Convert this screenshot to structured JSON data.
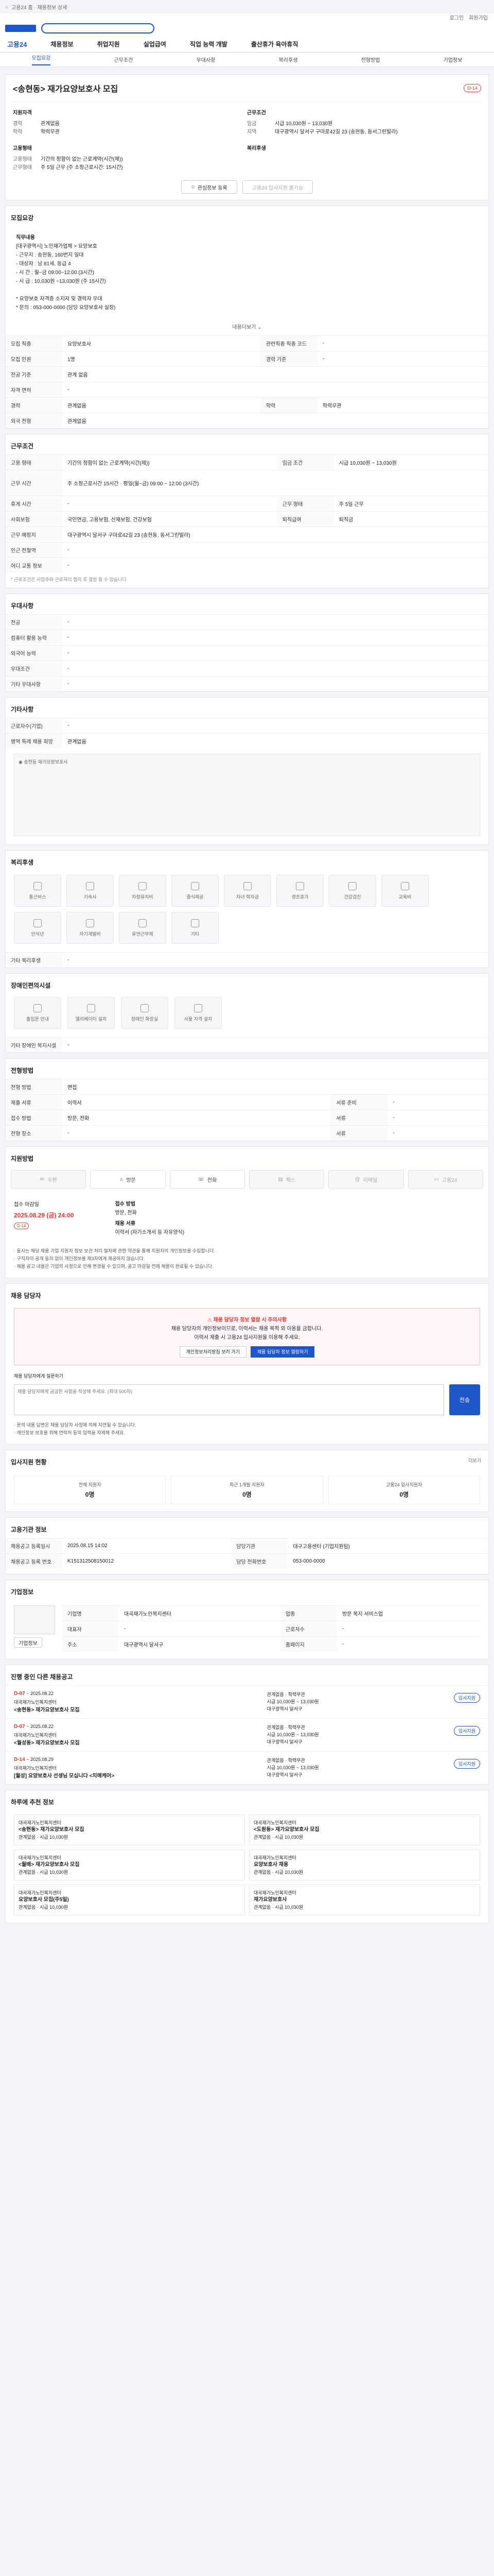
{
  "top": {
    "breadcrumb": "고용24 홈 · 채용정보 상세",
    "links": [
      "로그인",
      "회원가입"
    ]
  },
  "gnb": {
    "brand": "고용24",
    "items": [
      "채용정보",
      "취업지원",
      "실업급여",
      "직업 능력 개발",
      "출산휴가 육아휴직"
    ]
  },
  "tabs": [
    "모집요강",
    "근무조건",
    "우대사항",
    "복리후생",
    "전형방법",
    "기업정보"
  ],
  "job": {
    "title": "<송현동> 재가요양보호사 모집",
    "dday": "D-14",
    "left_head": "지원자격",
    "left_kv": [
      {
        "k": "경력",
        "v": "관계없음"
      },
      {
        "k": "학력",
        "v": "학력무관"
      }
    ],
    "left_head2": "고용형태",
    "left_kv2": [
      {
        "k": "고용형태",
        "v": "기간의 정함이 없는 근로계약(시간(제))"
      },
      {
        "k": "근무형태",
        "v": "주 5일 근무 (주 소정근로시간: 15시간)"
      }
    ],
    "right_head": "근무조건",
    "right_kv": [
      {
        "k": "임금",
        "v": "시급 10,030원 ~ 13,030원"
      },
      {
        "k": "지역",
        "v": "대구광역시 달서구 구마로42길 23 (송현동, 동서그린빌라)"
      }
    ],
    "right_head2": "복리후생",
    "btn_interest": "관심정보 등록",
    "btn_apply": "고용24 입사지원 불가능"
  },
  "recruit": {
    "title": "모집요강",
    "content_lines": [
      "직무내용",
      "[대구광역시] 노인재가업체 > 요양보호",
      "- 근무지 : 송현동, 160번지 일대",
      "- 대상자 : 남 81세, 등급 4",
      "- 시 간 : 월~금 09:00~12:00 (3시간)",
      "- 시 급 : 10,030원 ~13,030원 (주 15시간)",
      "",
      "* 요양보호 자격증 소지자 및 경력자 우대",
      "* 문의 : 053-000-0000 (담당 요양보호사 실장)"
    ],
    "more": "내용더보기"
  },
  "recruit_table": [
    {
      "h": "모집 직종",
      "v": "요양보호사",
      "h2": "관련직종 직종 코드",
      "v2": "-"
    },
    {
      "h": "모집 인원",
      "v": "1명",
      "h2": "경력 기준",
      "v2": "-"
    },
    {
      "h": "전공 기준",
      "v": "관계 없음",
      "h2": "",
      "v2": ""
    },
    {
      "h": "자격 면허",
      "v": "-",
      "h2": "",
      "v2": ""
    },
    {
      "h": "경력",
      "v": "관계없음",
      "h2": "학력",
      "v2": "학력무관"
    },
    {
      "h": "외국 전형",
      "v": "관계없음",
      "h2": "",
      "v2": ""
    }
  ],
  "work": {
    "title": "근무조건",
    "rows": [
      {
        "h": "고용 형태",
        "v": "기간의 정함이 없는 근로계약(시간(제))",
        "h2": "임금 조건",
        "v2": "시급 10,030원 ~ 13,030원"
      },
      {
        "h": "근무 시간",
        "v": "주 소정근로시간 15시간 · 평일(월~금) 09:00 ~ 12:00 (3시간)",
        "h2": "",
        "v2": ""
      },
      {
        "h": "휴게 시간",
        "v": "-",
        "h2": "근무 형태",
        "v2": "주 5일 근무"
      },
      {
        "h": "사회보험",
        "v": "국민연금, 고용보험, 산재보험, 건강보험",
        "h2": "퇴직급여",
        "v2": "퇴직금"
      },
      {
        "h": "근무 예정지",
        "v": "대구광역시 달서구 구마로42길 23 (송현동, 동서그린빌라)",
        "h2": "",
        "v2": ""
      },
      {
        "h": "인근 전철역",
        "v": "-",
        "h2": "",
        "v2": ""
      },
      {
        "h": "어디 교통 정보",
        "v": "-",
        "h2": "",
        "v2": ""
      }
    ],
    "note": "* 근로조건은 사업주와 근로자의 협의 후 결정 될 수 있습니다."
  },
  "prefer": {
    "title": "우대사항",
    "rows": [
      {
        "h": "전공",
        "v": "-"
      },
      {
        "h": "컴퓨터 활용 능력",
        "v": "-"
      },
      {
        "h": "외국어 능력",
        "v": "-"
      },
      {
        "h": "우대조건",
        "v": "-"
      },
      {
        "h": "기타 우대사항",
        "v": "-"
      }
    ]
  },
  "company_info": {
    "title": "기타사항",
    "rows": [
      {
        "h": "근로자수(기업)",
        "v": "-"
      },
      {
        "h": "병역 특례 채용 희망",
        "v": "관계없음"
      }
    ],
    "map_label": "송현동 재가요양보호사"
  },
  "welfare": {
    "title": "복리후생",
    "items": [
      "통근버스",
      "기숙사",
      "차량유지비",
      "중식제공",
      "자녀 학자금",
      "경조휴가",
      "건강검진",
      "교육비",
      "안식년",
      "자기계발비",
      "유연근무제",
      "기타"
    ],
    "etc_label": "기타 복리후생",
    "etc_value": "-"
  },
  "disability": {
    "title": "장애인편의시설",
    "items": [
      "출입문 안내",
      "엘리베이터 설치",
      "장애인 화장실",
      "사용 자격 설치"
    ],
    "info_label": "기타 장애인 복지시설",
    "info_value": "-"
  },
  "selection": {
    "title": "전형방법",
    "rows": [
      {
        "h": "전형 방법",
        "v": "면접"
      },
      {
        "h": "제출 서류",
        "v": "이력서",
        "h2": "서류 준비",
        "v2": "-"
      },
      {
        "h": "접수 방법",
        "v": "방문, 전화",
        "h2": "서류",
        "v2": "-"
      },
      {
        "h": "전형 장소",
        "v": "-",
        "h2": "서류",
        "v2": "-"
      }
    ]
  },
  "apply": {
    "title": "지원방법",
    "methods": [
      "우편",
      "방문",
      "전화",
      "팩스",
      "이메일",
      "고용24"
    ],
    "period_label": "접수 마감일",
    "period_value": "2025.08.29 (금) 24:00",
    "period_badge": "D-14",
    "contact_label": "접수 방법",
    "contact_value": "방문, 전화",
    "contact_label2": "채용 서류",
    "contact_value2": "이력서 (자기소개서 등 자유양식)",
    "bullets": [
      "· 동사는 해당 채용 기업 지원자 정보 보관 처리 절차에 관한 약관을 통해 지원자의 개인정보를 수집합니다.",
      "· 구직자의 공개 동의 없이 개인정보를 제3자에게 제공하지 않습니다.",
      "· 채용 공고 내용은 기업의 사정으로 인해 변경될 수 있으며, 공고 마감일 전에 채용이 완료될 수 있습니다."
    ]
  },
  "contact": {
    "title": "채용 담당자",
    "alert_red": "채용 담당자 정보 열람 시 주의사항",
    "alert_text1": "채용 담당자의 개인정보이므로, 이력서는 채용 목적 외 이용을 금합니다.",
    "alert_text2": "이력서 제출 시 고용24 입사지원을 이용해 주세요.",
    "btn1": "개인정보처리방침 보러 가기",
    "btn2": "채용 담당자 정보 열람하기",
    "qa_label": "채용 담당자에게 질문하기",
    "qa_placeholder": "채용 담당자에게 궁금한 사항을 작성해 주세요. (최대 500자)",
    "send": "전송",
    "notes": [
      "· 문의 내용 답변은 채용 담당자 사정에 의해 지연될 수 있습니다.",
      "· 개인정보 보호를 위해 연락처 등의 입력을 자제해 주세요."
    ]
  },
  "stats": {
    "title": "입사지원 현황",
    "more": "더보기",
    "items": [
      {
        "label": "전체 지원자",
        "value": "0명"
      },
      {
        "label": "최근 1개월 지원자",
        "value": "0명"
      },
      {
        "label": "고용24 입사지원자",
        "value": "0명"
      }
    ]
  },
  "meta": {
    "title": "고용기관 정보",
    "rows": [
      {
        "h": "채용공고 등록일시",
        "v": "2025.08.15 14:02",
        "h2": "담당기관",
        "v2": "대구고용센터 (기업지원팀)"
      },
      {
        "h": "채용공고 등록 번호",
        "v": "K151312508150012",
        "h2": "담당 전화번호",
        "v2": "053-000-0000"
      }
    ]
  },
  "employer": {
    "title": "기업정보",
    "rows": [
      {
        "h": "기업명",
        "v": "대곡재가노인복지센터",
        "h2": "업종",
        "v2": "방문 복지 서비스업"
      },
      {
        "h": "대표자",
        "v": "-",
        "h2": "근로자수",
        "v2": "-"
      },
      {
        "h": "주소",
        "v": "대구광역시 달서구",
        "h2": "홈페이지",
        "v2": "-"
      }
    ],
    "btn": "기업정보"
  },
  "similar": {
    "title": "진행 중인 다른 채용공고",
    "items": [
      {
        "dday": "D-07",
        "date": "~ 2025.08.22",
        "company": "대곡재가노인복지센터",
        "title": "<송현동> 재가요양보호사 모집",
        "cond1": "관계없음 · 학력무관",
        "cond2": "시급 10,030원 ~ 13,030원",
        "cond3": "대구광역시 달서구",
        "apply": "입사지원"
      },
      {
        "dday": "D-07",
        "date": "~ 2025.08.22",
        "company": "대곡재가노인복지센터",
        "title": "<월성동> 재가요양보호사 모집",
        "cond1": "관계없음 · 학력무관",
        "cond2": "시급 10,030원 ~ 13,030원",
        "cond3": "대구광역시 달서구",
        "apply": "입사지원"
      },
      {
        "dday": "D-14",
        "date": "~ 2025.08.29",
        "company": "대곡재가노인복지센터",
        "title": "[월성] 요양보호사 선생님 모십니다 <치매케어>",
        "cond1": "관계없음 · 학력무관",
        "cond2": "시급 10,030원 ~ 13,030원",
        "cond3": "대구광역시 달서구",
        "apply": "입사지원"
      }
    ]
  },
  "reco": {
    "title": "하루에 추천 정보",
    "items": [
      {
        "company": "대곡재가노인복지센터",
        "title": "<송현동> 재가요양보호사 모집",
        "info": "관계없음 · 시급 10,030원"
      },
      {
        "company": "대곡재가노인복지센터",
        "title": "<도원동> 재가요양보호사 모집",
        "info": "관계없음 · 시급 10,030원"
      },
      {
        "company": "대곡재가노인복지센터",
        "title": "<월배> 재가요양보호사 모집",
        "info": "관계없음 · 시급 10,030원"
      },
      {
        "company": "대곡재가노인복지센터",
        "title": "요양보호사 채용",
        "info": "관계없음 · 시급 10,030원"
      },
      {
        "company": "대곡재가노인복지센터",
        "title": "요양보호사 모집(주5일)",
        "info": "관계없음 · 시급 10,030원"
      },
      {
        "company": "대곡재가노인복지센터",
        "title": "재가요양보호사",
        "info": "관계없음 · 시급 10,030원"
      }
    ]
  }
}
